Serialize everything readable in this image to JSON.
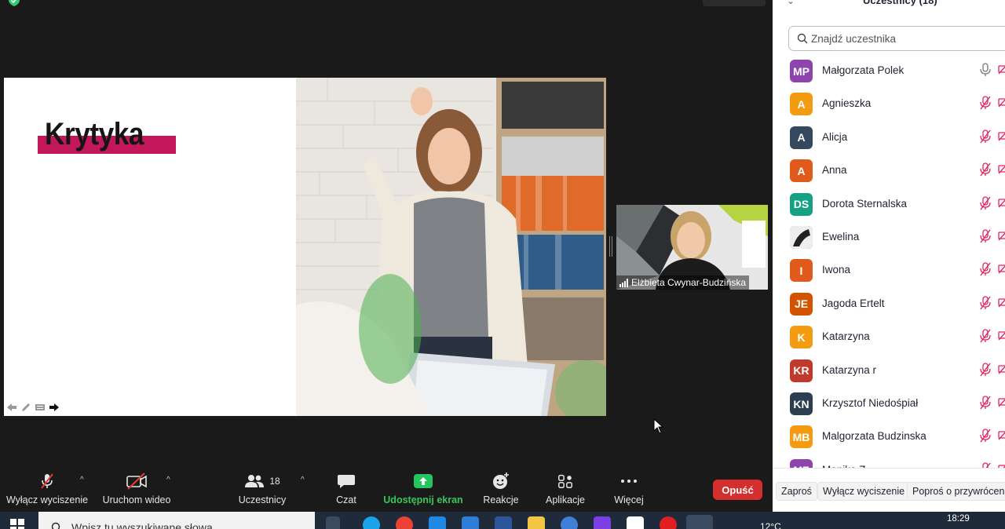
{
  "slide": {
    "title": "Krytyka"
  },
  "speaker": {
    "name": "Elżbieta Cwynar-Budzińska"
  },
  "toolbar": {
    "mute_label": "Wyłącz wyciszenie",
    "video_label": "Uruchom wideo",
    "participants_label": "Uczestnicy",
    "participants_count": "18",
    "chat_label": "Czat",
    "share_label": "Udostępnij ekran",
    "reactions_label": "Reakcje",
    "apps_label": "Aplikacje",
    "more_label": "Więcej",
    "leave_label": "Opuść"
  },
  "panel": {
    "title": "Uczestnicy (18)",
    "search_placeholder": "Znajdź uczestnika",
    "participants": [
      {
        "initials": "MP",
        "name": "Małgorzata Polek",
        "color": "#8e44ad",
        "mic": "on"
      },
      {
        "initials": "A",
        "name": "Agnieszka",
        "color": "#f39c12",
        "mic": "muted"
      },
      {
        "initials": "A",
        "name": "Alicja",
        "color": "#34495e",
        "mic": "muted"
      },
      {
        "initials": "A",
        "name": "Anna",
        "color": "#e05a1c",
        "mic": "muted"
      },
      {
        "initials": "DS",
        "name": "Dorota Sternalska",
        "color": "#16a085",
        "mic": "muted"
      },
      {
        "initials": "",
        "name": "Ewelina",
        "color": "#2c2c2c",
        "mic": "muted"
      },
      {
        "initials": "I",
        "name": "Iwona",
        "color": "#e05a1c",
        "mic": "muted"
      },
      {
        "initials": "JE",
        "name": "Jagoda Ertelt",
        "color": "#d35400",
        "mic": "muted"
      },
      {
        "initials": "K",
        "name": "Katarzyna",
        "color": "#f39c12",
        "mic": "muted"
      },
      {
        "initials": "KR",
        "name": "Katarzyna r",
        "color": "#c0392b",
        "mic": "muted"
      },
      {
        "initials": "KN",
        "name": "Krzysztof Niedośpiał",
        "color": "#2c3e50",
        "mic": "muted"
      },
      {
        "initials": "MB",
        "name": "Malgorzata Budzinska",
        "color": "#f39c12",
        "mic": "muted"
      },
      {
        "initials": "MZ",
        "name": "Monika Z...",
        "color": "#8e44ad",
        "mic": "muted"
      }
    ],
    "footer": {
      "invite_label": "Zaproś",
      "unmute_label": "Wyłącz wyciszenie",
      "ask_label": "Poproś o przywrócenie"
    }
  },
  "taskbar": {
    "search_placeholder": "Wpisz tu wyszukiwane słowa",
    "temperature": "12°C",
    "time": "18:29"
  }
}
